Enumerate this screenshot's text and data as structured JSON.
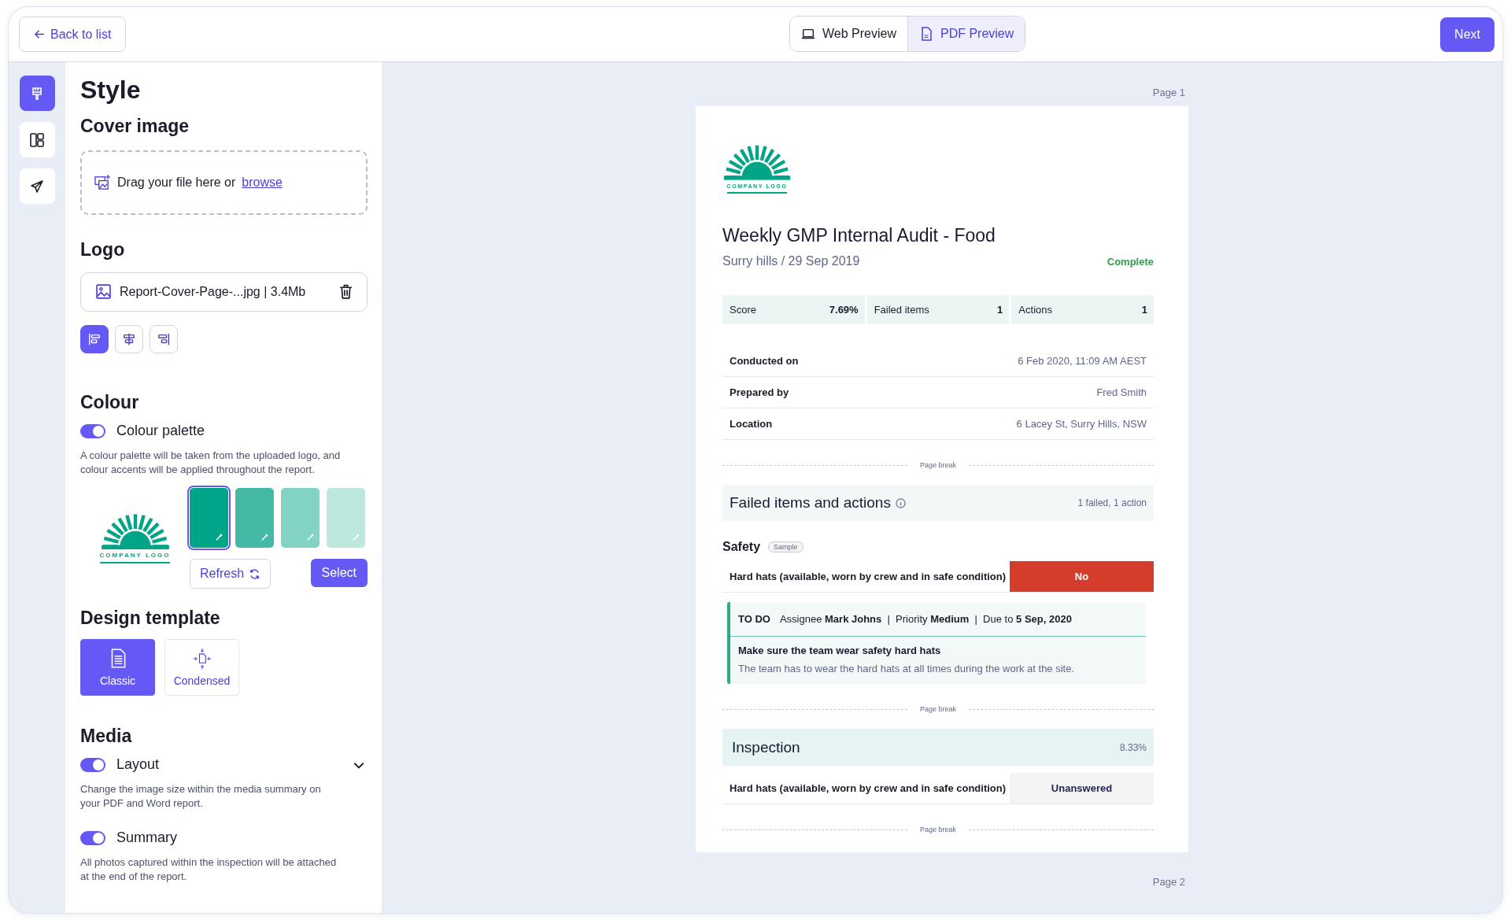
{
  "header": {
    "back_button": "Back to list",
    "preview_tabs": [
      {
        "label": "Web Preview",
        "selected": false
      },
      {
        "label": "PDF Preview",
        "selected": true
      }
    ],
    "next_button": "Next"
  },
  "rail": [
    {
      "selected": true
    },
    {
      "selected": false
    },
    {
      "selected": false
    }
  ],
  "style_panel": {
    "title": "Style",
    "cover_image": {
      "heading": "Cover image",
      "prompt": "Drag your file here or",
      "link": "browse"
    },
    "logo": {
      "heading": "Logo",
      "file_name": "Report-Cover-Page-...jpg | 3.4Mb",
      "alignments": [
        {
          "selected": true
        },
        {
          "selected": false
        },
        {
          "selected": false
        }
      ]
    },
    "colour": {
      "heading": "Colour",
      "toggle": {
        "label": "Colour palette",
        "on": true
      },
      "description": "A colour palette will be taken from the uploaded logo, and colour accents will be applied throughout the report.",
      "logo_text": "COMPANY LOGO",
      "swatches": [
        {
          "color": "#00a587",
          "selected": true
        },
        {
          "color": "#44b9a3",
          "selected": false
        },
        {
          "color": "#82d3c4",
          "selected": false
        },
        {
          "color": "#bde8e0",
          "selected": false
        }
      ],
      "refresh_button": "Refresh",
      "select_button": "Select"
    },
    "design_template": {
      "heading": "Design template",
      "options": [
        {
          "label": "Classic",
          "selected": true
        },
        {
          "label": "Condensed",
          "selected": false
        }
      ]
    },
    "media": {
      "heading": "Media",
      "toggles": [
        {
          "label": "Layout",
          "on": true,
          "expandable": true,
          "description": "Change the image size within the media summary on your PDF and Word report."
        },
        {
          "label": "Summary",
          "on": true,
          "expandable": false,
          "description": "All photos captured within the inspection will be attached at the end of the report."
        }
      ]
    }
  },
  "preview": {
    "page_labels": [
      "Page 1",
      "Page 2"
    ],
    "report": {
      "logo_text": "COMPANY LOGO",
      "title": "Weekly GMP Internal Audit - Food",
      "subtitle": "Surry hills / 29 Sep 2019",
      "status": "Complete",
      "stats": [
        {
          "label": "Score",
          "value": "7.69%"
        },
        {
          "label": "Failed items",
          "value": "1"
        },
        {
          "label": "Actions",
          "value": "1"
        }
      ],
      "details": [
        {
          "label": "Conducted on",
          "value": "6 Feb 2020, 11:09 AM AEST"
        },
        {
          "label": "Prepared by",
          "value": "Fred Smith"
        },
        {
          "label": "Location",
          "value": "6 Lacey St, Surry Hills, NSW"
        }
      ],
      "blocks": [
        {
          "kind": "page_break",
          "text": "Page break"
        },
        {
          "kind": "section",
          "title": "Failed items and actions",
          "info": true,
          "summary": "1 failed, 1 action"
        },
        {
          "kind": "group",
          "title": "Safety",
          "badge": "Sample"
        },
        {
          "kind": "question",
          "text": "Hard hats (available, worn by crew and in safe condition)",
          "answer": "No",
          "color": "#d43c2b"
        },
        {
          "kind": "action",
          "status": "TO DO",
          "meta": "Assignee **Mark Johns**  |  Priority **Medium**  |  Due to **5 Sep, 2020**",
          "title": "Make sure the team wear safety hard hats",
          "description": "The team has to wear the hard hats at all times during the work at the site."
        },
        {
          "kind": "page_break",
          "text": "Page break"
        },
        {
          "kind": "section",
          "title": "Inspection",
          "info": false,
          "summary": "8.33%"
        },
        {
          "kind": "question",
          "text": "Hard hats (available, worn by crew and in safe condition)",
          "answer": "Unanswered",
          "color": "#f4f4f5"
        },
        {
          "kind": "page_break",
          "text": "Page break"
        }
      ]
    }
  }
}
